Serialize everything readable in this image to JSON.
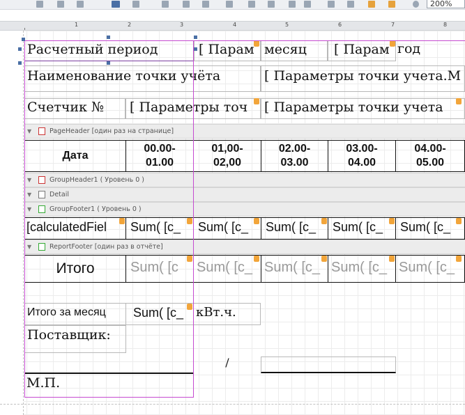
{
  "toolbar": {
    "zoom": "200%"
  },
  "ruler": {
    "marks": [
      "1",
      "2",
      "3",
      "4",
      "5",
      "6",
      "7",
      "8"
    ]
  },
  "report": {
    "row1": {
      "period_label": "Расчетный период",
      "param1": "[ Парам",
      "month": "месяц",
      "param2": "[ Парам",
      "year": "год"
    },
    "row2": {
      "point_label": "Наименование  точки  учёта",
      "point_param": "[ Параметры точки учета.М"
    },
    "row3": {
      "meter_label": "Счетчик №",
      "meter_param1": "[ Параметры точ",
      "meter_param2": "[ Параметры точки учета"
    },
    "page_header_band": "PageHeader [один раз на странице]",
    "header_cols": {
      "date": "Дата",
      "h1": "00.00-01.00",
      "h2": "01,00-02,00",
      "h3": "02.00-03.00",
      "h4": "03.00-04.00",
      "h5": "04.00-05.00"
    },
    "group_header_band": "GroupHeader1 ( Уровень 0 )",
    "detail_band": "Detail",
    "group_footer_band": "GroupFooter1 ( Уровень 0 )",
    "group_footer_row": {
      "calc": "[calculatedFiel",
      "sum": "Sum( [c_"
    },
    "report_footer_band": "ReportFooter [один раз в отчёте]",
    "total_row": {
      "label": "Итого",
      "sum1": "Sum( [c",
      "sum": "Sum( [c_"
    },
    "monthly": {
      "label": "Итого за месяц",
      "sum": "Sum( [c_",
      "unit": "кВт.ч."
    },
    "supplier_label": "Поставщик:",
    "slash": "/",
    "stamp_label": "М.П."
  }
}
